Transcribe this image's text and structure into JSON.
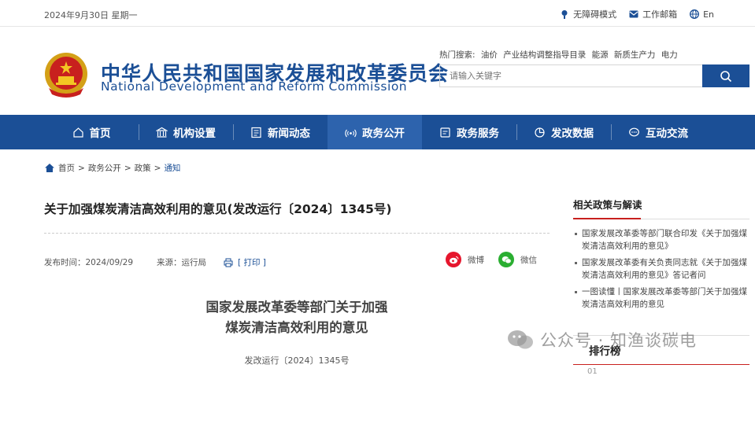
{
  "topbar": {
    "date": "2024年9月30日 星期一",
    "accessible": "无障碍模式",
    "mail": "工作邮箱",
    "lang": "En"
  },
  "header": {
    "name_cn": "中华人民共和国国家发展和改革委员会",
    "name_en": "National Development and Reform Commission",
    "hot_label": "热门搜索:",
    "hot_items": [
      "油价",
      "产业结构调整指导目录",
      "能源",
      "新质生产力",
      "电力"
    ],
    "search_placeholder": "请输入关键字"
  },
  "nav": [
    {
      "label": "首页",
      "icon": "home-icon"
    },
    {
      "label": "机构设置",
      "icon": "building-icon"
    },
    {
      "label": "新闻动态",
      "icon": "news-icon"
    },
    {
      "label": "政务公开",
      "icon": "broadcast-icon",
      "active": true
    },
    {
      "label": "政务服务",
      "icon": "service-icon"
    },
    {
      "label": "发改数据",
      "icon": "chart-icon"
    },
    {
      "label": "互动交流",
      "icon": "chat-icon"
    }
  ],
  "breadcrumb": [
    "首页",
    "政务公开",
    "政策",
    "通知"
  ],
  "article": {
    "title": "关于加强煤炭清洁高效利用的意见(发改运行〔2024〕1345号)",
    "date_label": "发布时间：2024/09/29",
    "source_label": "来源：运行局",
    "print": "[ 打印 ]",
    "share_weibo": "微博",
    "share_wechat": "微信",
    "doc_title_line1": "国家发展改革委等部门关于加强",
    "doc_title_line2": "煤炭清洁高效利用的意见",
    "doc_no": "发改运行〔2024〕1345号"
  },
  "sidebar": {
    "related_title": "相关政策与解读",
    "related": [
      "国家发展改革委等部门联合印发《关于加强煤炭清洁高效利用的意见》",
      "国家发展改革委有关负责同志就《关于加强煤炭清洁高效利用的意见》答记者问",
      "一图读懂丨国家发展改革委等部门关于加强煤炭清洁高效利用的意见"
    ],
    "rank_title": "排行榜",
    "rank_first": "01"
  },
  "watermark": "公众号 · 知渔谈碳电",
  "colors": {
    "brand": "#1b4f96",
    "accent": "#c8201e"
  }
}
